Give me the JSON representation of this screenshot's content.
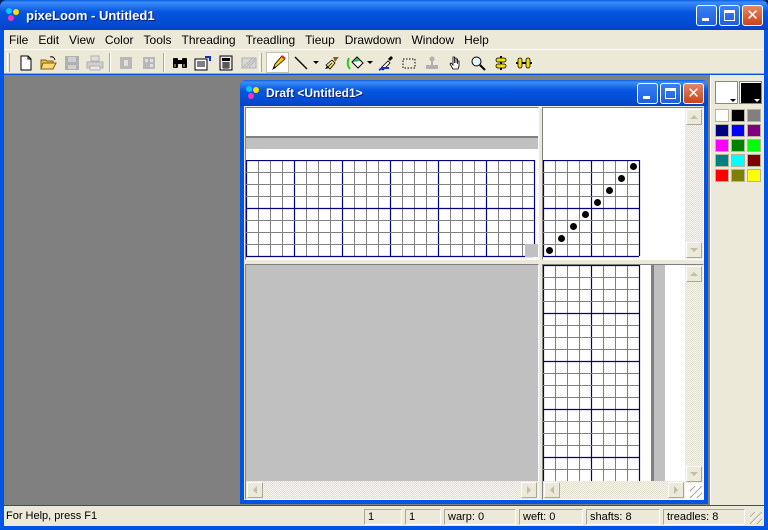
{
  "app": {
    "title": "pixeLoom - Untitled1",
    "window_buttons": [
      "minimize",
      "maximize",
      "close"
    ]
  },
  "menu": [
    "File",
    "Edit",
    "View",
    "Color",
    "Tools",
    "Threading",
    "Treadling",
    "Tieup",
    "Drawdown",
    "Window",
    "Help"
  ],
  "toolbar": {
    "groups": [
      [
        {
          "icon": "new-file-icon",
          "enabled": true
        },
        {
          "icon": "open-folder-icon",
          "enabled": true
        },
        {
          "icon": "save-icon",
          "enabled": false
        },
        {
          "icon": "print-icon",
          "enabled": false
        }
      ],
      [
        {
          "icon": "shaft-icon",
          "enabled": false
        },
        {
          "icon": "treadle-icon",
          "enabled": false
        }
      ],
      [
        {
          "icon": "binoculars-icon",
          "enabled": true
        },
        {
          "icon": "properties-icon",
          "enabled": true
        },
        {
          "icon": "calculator-icon",
          "enabled": true
        },
        {
          "icon": "pattern-icon",
          "enabled": false
        }
      ],
      [
        {
          "icon": "pencil-icon",
          "enabled": true,
          "active": true
        },
        {
          "icon": "line-icon",
          "enabled": true,
          "dropdown": true
        },
        {
          "icon": "brush-icon",
          "enabled": true
        },
        {
          "icon": "fill-icon",
          "enabled": true,
          "dropdown": true
        },
        {
          "icon": "eyedropper-icon",
          "enabled": true
        },
        {
          "icon": "select-rect-icon",
          "enabled": true
        },
        {
          "icon": "stamp-icon",
          "enabled": false
        },
        {
          "icon": "hand-icon",
          "enabled": true
        },
        {
          "icon": "zoom-icon",
          "enabled": true
        },
        {
          "icon": "center-icon",
          "enabled": true
        },
        {
          "icon": "spread-icon",
          "enabled": true
        }
      ]
    ]
  },
  "palette": {
    "foreground": "#ffffff",
    "background": "#000000",
    "colors": [
      "#ffffff",
      "#000000",
      "#808080",
      "#000080",
      "#0000ff",
      "#800080",
      "#ff00ff",
      "#008000",
      "#00ff00",
      "#008080",
      "#00ffff",
      "#800000",
      "#ff0000",
      "#808000",
      "#ffff00"
    ]
  },
  "draft": {
    "title": "Draft <Untitled1>",
    "threading": {
      "rows": 8,
      "cols": 24,
      "group": 4
    },
    "tieup": {
      "rows": 8,
      "cols": 8,
      "group": 4,
      "dots": [
        [
          1,
          1
        ],
        [
          2,
          2
        ],
        [
          3,
          3
        ],
        [
          4,
          4
        ],
        [
          5,
          5
        ],
        [
          6,
          6
        ],
        [
          7,
          7
        ],
        [
          8,
          8
        ]
      ]
    },
    "treadling": {
      "cols": 8,
      "group": 4
    }
  },
  "colors": {
    "grid_line": "#808080",
    "grid_major": "#000080",
    "mdi_background": "#808080"
  },
  "status": {
    "help": "For Help, press F1",
    "panels": [
      "1",
      "1",
      "warp: 0",
      "weft: 0",
      "shafts: 8",
      "treadles: 8"
    ]
  }
}
